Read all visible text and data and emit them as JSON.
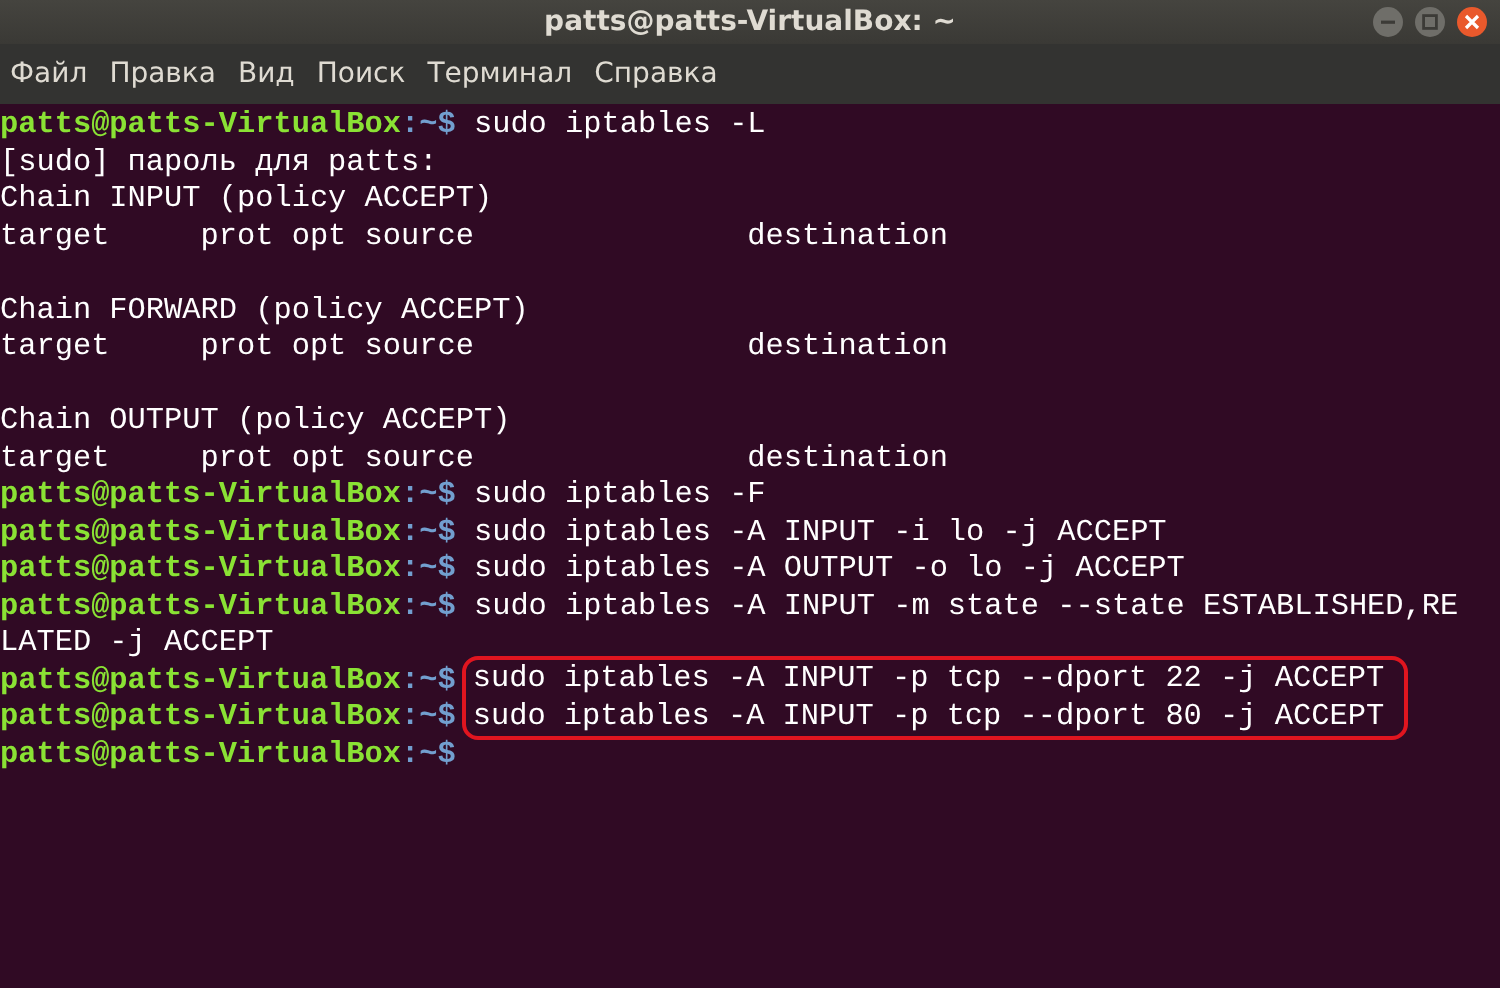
{
  "window": {
    "title": "patts@patts-VirtualBox: ~"
  },
  "menu": [
    "Файл",
    "Правка",
    "Вид",
    "Поиск",
    "Терминал",
    "Справка"
  ],
  "terminal": {
    "lines": [
      {
        "kind": "prompt",
        "user": "patts@patts-VirtualBox",
        "path": ":~$",
        "text": "sudo iptables -L"
      },
      {
        "kind": "output",
        "text": "[sudo] пароль для patts:"
      },
      {
        "kind": "output",
        "text": "Chain INPUT (policy ACCEPT)"
      },
      {
        "kind": "output",
        "text": "target     prot opt source               destination"
      },
      {
        "kind": "blank"
      },
      {
        "kind": "output",
        "text": "Chain FORWARD (policy ACCEPT)"
      },
      {
        "kind": "output",
        "text": "target     prot opt source               destination"
      },
      {
        "kind": "blank"
      },
      {
        "kind": "output",
        "text": "Chain OUTPUT (policy ACCEPT)"
      },
      {
        "kind": "output",
        "text": "target     prot opt source               destination"
      },
      {
        "kind": "prompt",
        "user": "patts@patts-VirtualBox",
        "path": ":~$",
        "text": "sudo iptables -F"
      },
      {
        "kind": "prompt",
        "user": "patts@patts-VirtualBox",
        "path": ":~$",
        "text": "sudo iptables -A INPUT -i lo -j ACCEPT"
      },
      {
        "kind": "prompt",
        "user": "patts@patts-VirtualBox",
        "path": ":~$",
        "text": "sudo iptables -A OUTPUT -o lo -j ACCEPT"
      },
      {
        "kind": "prompt",
        "user": "patts@patts-VirtualBox",
        "path": ":~$",
        "text": "sudo iptables -A INPUT -m state --state ESTABLISHED,RE"
      },
      {
        "kind": "output",
        "text": "LATED -j ACCEPT"
      },
      {
        "kind": "group",
        "highlighted": true,
        "lines": [
          {
            "user": "patts@patts-VirtualBox",
            "path": ":~$",
            "text": "sudo iptables -A INPUT -p tcp --dport 22 -j ACCEPT"
          },
          {
            "user": "patts@patts-VirtualBox",
            "path": ":~$",
            "text": "sudo iptables -A INPUT -p tcp --dport 80 -j ACCEPT"
          }
        ]
      },
      {
        "kind": "prompt",
        "user": "patts@patts-VirtualBox",
        "path": ":~$"
      }
    ]
  }
}
